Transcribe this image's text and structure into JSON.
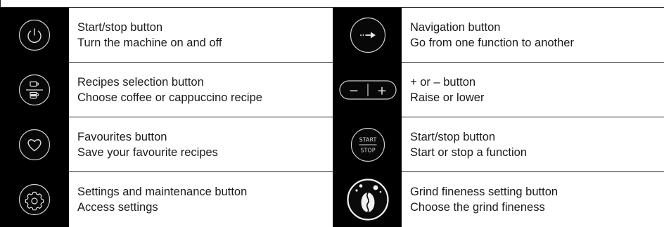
{
  "rows": [
    {
      "left": {
        "icon": "power-icon",
        "title": "Start/stop button",
        "desc": "Turn the machine on and off"
      },
      "right": {
        "icon": "arrow-right-icon",
        "title": "Navigation button",
        "desc": "Go from one function to another"
      }
    },
    {
      "left": {
        "icon": "cup-recipes-icon",
        "title": "Recipes selection button",
        "desc": "Choose coffee or cappuccino recipe"
      },
      "right": {
        "icon": "plus-minus-icon",
        "title": "+ or – button",
        "desc": "Raise or lower"
      }
    },
    {
      "left": {
        "icon": "heart-icon",
        "title": "Favourites button",
        "desc": "Save your favourite recipes"
      },
      "right": {
        "icon": "start-stop-icon",
        "title": "Start/stop button",
        "desc": "Start or stop a function",
        "icon_text": {
          "top": "START",
          "bottom": "STOP"
        }
      }
    },
    {
      "left": {
        "icon": "gear-icon",
        "title": "Settings and maintenance button",
        "desc": "Access settings"
      },
      "right": {
        "icon": "coffee-bean-icon",
        "title": "Grind fineness setting button",
        "desc": "Choose the grind fineness"
      }
    }
  ],
  "minus_plus": {
    "minus": "−",
    "plus": "+"
  },
  "colors": {
    "icon_bg": "#000000",
    "icon_stroke": "#cfcfcf",
    "bean_bg": "#f2f2f2"
  }
}
